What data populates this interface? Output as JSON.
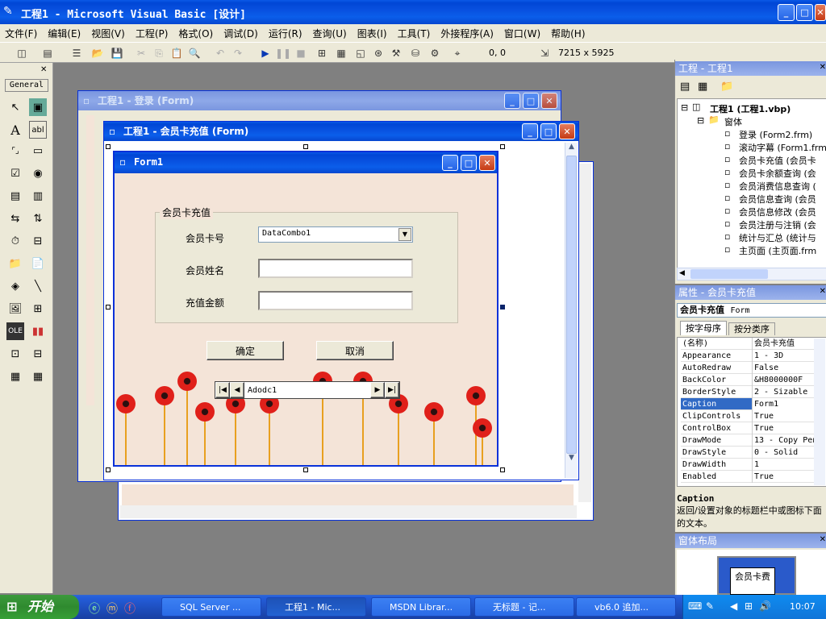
{
  "app": {
    "title": "工程1 - Microsoft Visual Basic [设计]"
  },
  "menu": [
    "文件(F)",
    "编辑(E)",
    "视图(V)",
    "工程(P)",
    "格式(O)",
    "调试(D)",
    "运行(R)",
    "查询(U)",
    "图表(I)",
    "工具(T)",
    "外接程序(A)",
    "窗口(W)",
    "帮助(H)"
  ],
  "toolbar": {
    "pos": "0, 0",
    "size": "7215 x 5925"
  },
  "toolbox": {
    "header": "General"
  },
  "windows": {
    "login": {
      "title": "工程1 - 登录 (Form)"
    },
    "recharge": {
      "title": "工程1 - 会员卡充值 (Form)"
    },
    "form1": {
      "title": "Form1"
    }
  },
  "form": {
    "frame_caption": "会员卡充值",
    "card_label": "会员卡号",
    "combo_value": "DataCombo1",
    "name_label": "会员姓名",
    "amount_label": "充值金额",
    "ok_button": "确定",
    "cancel_button": "取消",
    "adodc_caption": "Adodc1"
  },
  "project": {
    "title": "工程 - 工程1",
    "root": "工程1 (工程1.vbp)",
    "folder": "窗体",
    "items": [
      "登录 (Form2.frm)",
      "滚动字幕 (Form1.frm",
      "会员卡充值 (会员卡",
      "会员卡余额查询 (会",
      "会员消费信息查询 (",
      "会员信息查询 (会员",
      "会员信息修改 (会员",
      "会员注册与注销 (会",
      "统计与汇总 (统计与",
      "主页面 (主页面.frm"
    ]
  },
  "properties": {
    "title": "属性 - 会员卡充值",
    "object": "会员卡充值",
    "object_type": "Form",
    "tab_alpha": "按字母序",
    "tab_category": "按分类序",
    "rows": [
      {
        "k": "(名称)",
        "v": "会员卡充值"
      },
      {
        "k": "Appearance",
        "v": "1 - 3D"
      },
      {
        "k": "AutoRedraw",
        "v": "False"
      },
      {
        "k": "BackColor",
        "v": "&H8000000F"
      },
      {
        "k": "BorderStyle",
        "v": "2 - Sizable"
      },
      {
        "k": "Caption",
        "v": "Form1"
      },
      {
        "k": "ClipControls",
        "v": "True"
      },
      {
        "k": "ControlBox",
        "v": "True"
      },
      {
        "k": "DrawMode",
        "v": "13 - Copy Pen"
      },
      {
        "k": "DrawStyle",
        "v": "0 - Solid"
      },
      {
        "k": "DrawWidth",
        "v": "1"
      },
      {
        "k": "Enabled",
        "v": "True"
      }
    ],
    "desc_title": "Caption",
    "desc_text": "返回/设置对象的标题栏中或图标下面的文本。"
  },
  "layout": {
    "title": "窗体布局",
    "thumb": "会员卡费"
  },
  "taskbar": {
    "start": "开始",
    "tasks": [
      "SQL Server ...",
      "工程1 - Mic...",
      "MSDN Librar...",
      "无标题 - 记...",
      "vb6.0 追加..."
    ],
    "clock": "10:07"
  },
  "colors": {
    "form_bg": "#f4e4d8",
    "xp_blue": "#0a5ae8",
    "flower": "#e0201a"
  }
}
